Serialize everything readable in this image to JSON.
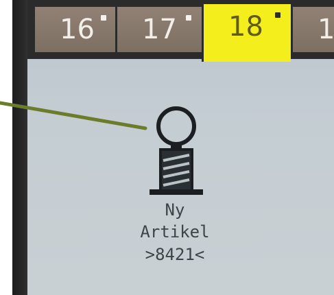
{
  "tabs": [
    {
      "label": "16",
      "active": false
    },
    {
      "label": "17",
      "active": false
    },
    {
      "label": "18",
      "active": true
    },
    {
      "label": "1",
      "active": false
    }
  ],
  "item": {
    "line1": "Ny",
    "line2": "Artikel",
    "line3": ">8421<",
    "icon": "thread-spool-icon"
  },
  "colors": {
    "active_tab": "#f3ee1c",
    "inactive_tab": "#8a7b6f",
    "screen_bg": "#c4cdd2",
    "callout_line": "#6b7d2a"
  }
}
